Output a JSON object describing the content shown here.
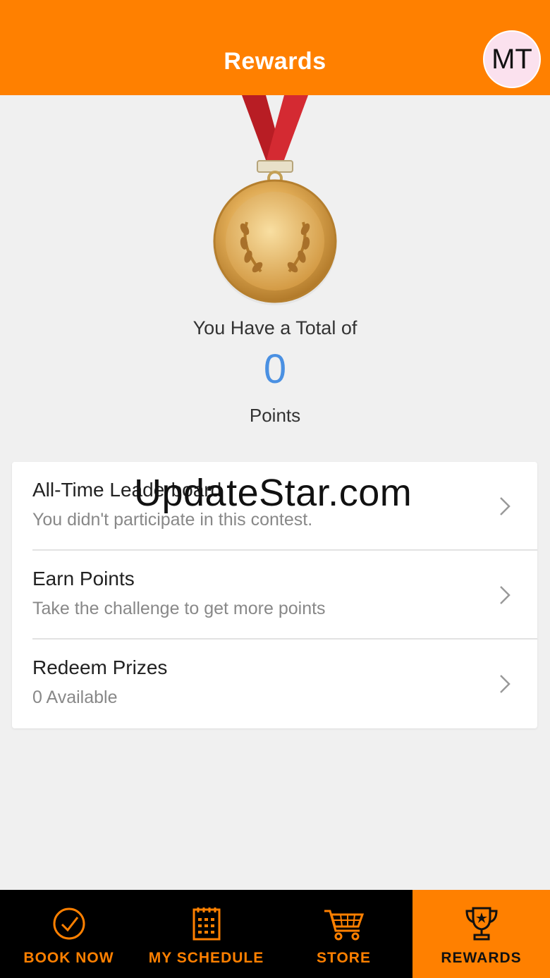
{
  "header": {
    "title": "Rewards",
    "avatar_initials": "MT"
  },
  "summary": {
    "total_label": "You Have a Total of",
    "points_value": "0",
    "points_label": "Points"
  },
  "menu": {
    "items": [
      {
        "title": "All-Time Leaderboard",
        "subtitle": "You didn't participate in this contest."
      },
      {
        "title": "Earn Points",
        "subtitle": "Take the challenge to get more points"
      },
      {
        "title": "Redeem Prizes",
        "subtitle": "0 Available"
      }
    ]
  },
  "watermark": "UpdateStar.com",
  "bottom_nav": {
    "items": [
      {
        "label": "BOOK NOW",
        "icon": "check-circle-icon"
      },
      {
        "label": "MY SCHEDULE",
        "icon": "calendar-icon"
      },
      {
        "label": "STORE",
        "icon": "cart-icon"
      },
      {
        "label": "REWARDS",
        "icon": "trophy-icon",
        "active": true
      }
    ]
  },
  "colors": {
    "accent": "#ff8000",
    "points": "#4a90e2",
    "nav_background": "#000000"
  }
}
